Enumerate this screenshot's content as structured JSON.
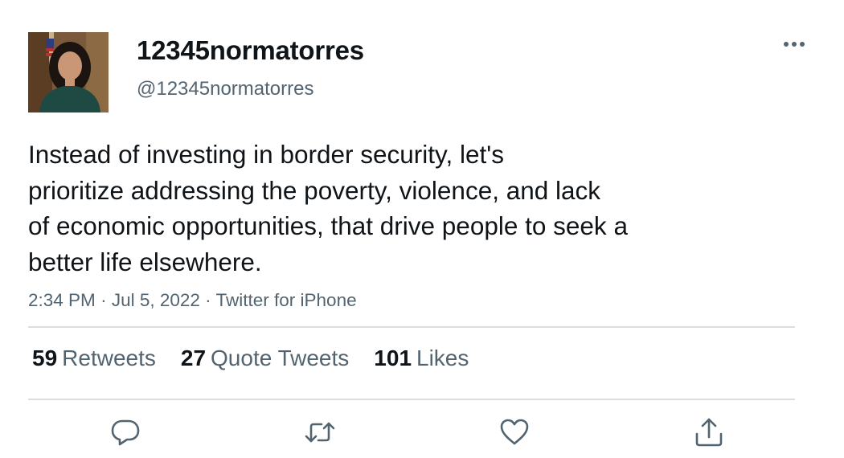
{
  "user": {
    "display_name": "12345normatorres",
    "handle": "@12345normatorres"
  },
  "tweet": {
    "text_lines": [
      "Instead of investing in border security, let's",
      "prioritize addressing the poverty, violence, and lack",
      "of economic opportunities, that drive people to seek a",
      "better life elsewhere."
    ],
    "time": "2:34 PM",
    "date": "Jul 5, 2022",
    "source": "Twitter for iPhone",
    "separator": "·"
  },
  "stats": {
    "retweets": {
      "count": "59",
      "label": "Retweets"
    },
    "quotes": {
      "count": "27",
      "label": "Quote Tweets"
    },
    "likes": {
      "count": "101",
      "label": "Likes"
    }
  },
  "icons": {
    "more": "more-horizontal-icon",
    "reply": "reply-icon",
    "retweet": "retweet-icon",
    "like": "heart-icon",
    "share": "share-icon"
  },
  "colors": {
    "text": "#0f1419",
    "secondary": "#536471",
    "divider": "#d9dee2"
  }
}
